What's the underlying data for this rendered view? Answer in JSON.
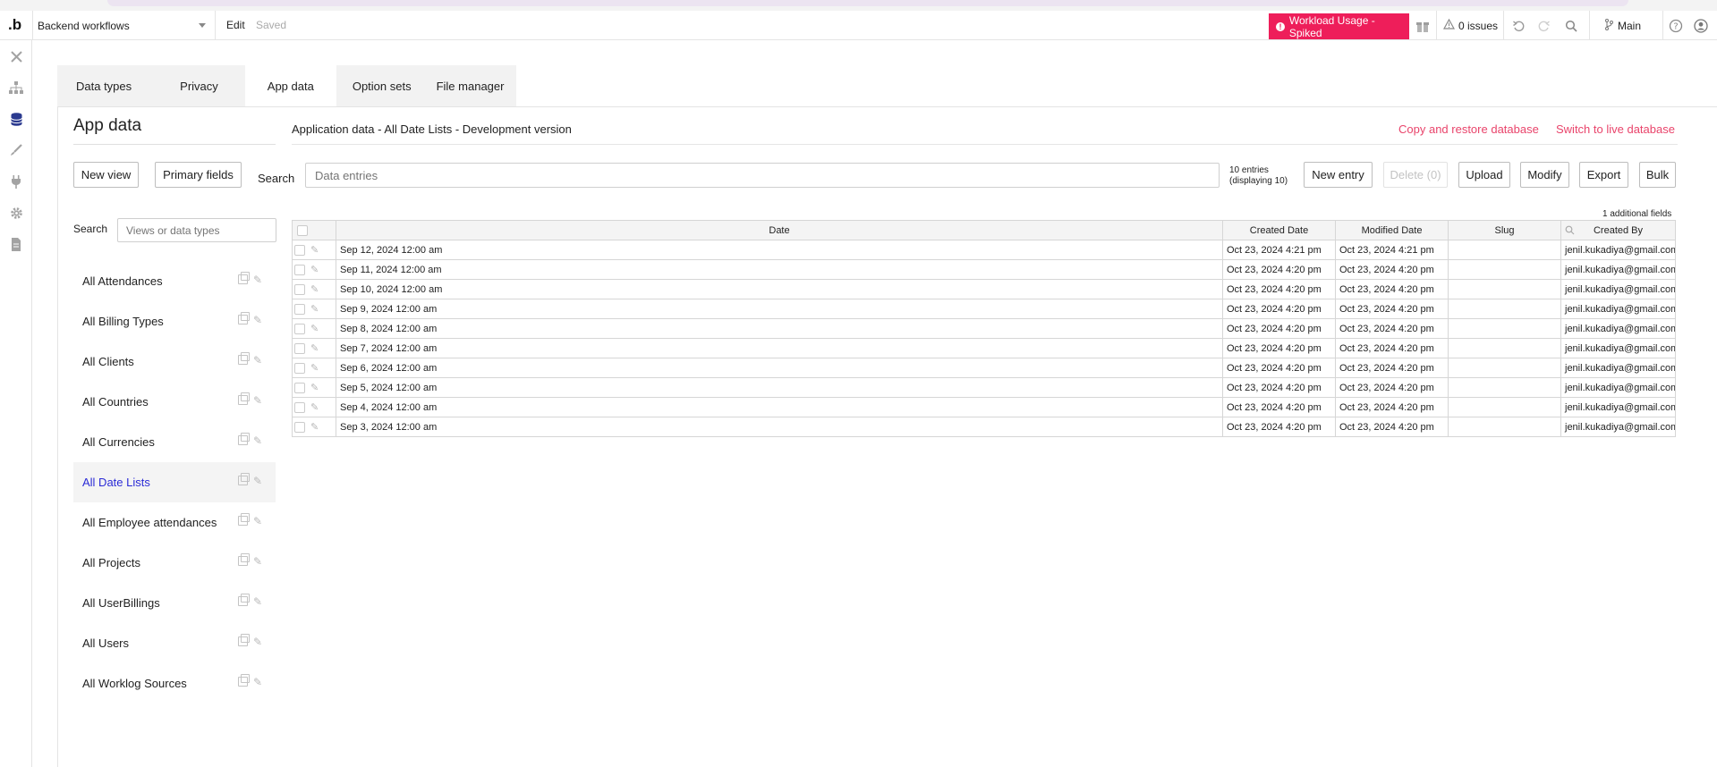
{
  "topbar": {
    "logo": ".b",
    "page_selector": "Backend workflows",
    "edit_label": "Edit",
    "saved_label": "Saved",
    "workload_label": "Workload Usage - Spiked",
    "issues_label": "0 issues",
    "branch_label": "Main",
    "colors": {
      "workload": "#ee1e5a",
      "link": "#e9446b",
      "active_nav": "#2b2bd6"
    }
  },
  "tabs": [
    {
      "label": "Data types"
    },
    {
      "label": "Privacy"
    },
    {
      "label": "App data"
    },
    {
      "label": "Option sets"
    },
    {
      "label": "File manager"
    }
  ],
  "left": {
    "title": "App data",
    "new_view": "New view",
    "primary_fields": "Primary fields",
    "search_label": "Search",
    "search_placeholder": "Views or data types",
    "types": [
      {
        "label": "All Attendances"
      },
      {
        "label": "All Billing Types"
      },
      {
        "label": "All Clients"
      },
      {
        "label": "All Countries"
      },
      {
        "label": "All Currencies"
      },
      {
        "label": "All Date Lists"
      },
      {
        "label": "All Employee attendances"
      },
      {
        "label": "All Projects"
      },
      {
        "label": "All UserBillings"
      },
      {
        "label": "All Users"
      },
      {
        "label": "All Worklog Sources"
      }
    ]
  },
  "main": {
    "headline": "Application data - All Date Lists - Development version",
    "copy_restore": "Copy and restore database",
    "switch_live": "Switch to live database",
    "search_label": "Search",
    "search_placeholder": "Data entries",
    "entries_line1": "10 entries",
    "entries_line2": "(displaying 10)",
    "buttons": {
      "new_entry": "New entry",
      "delete": "Delete (0)",
      "upload": "Upload",
      "modify": "Modify",
      "export": "Export",
      "bulk": "Bulk"
    },
    "additional_fields": "1 additional fields",
    "columns": [
      "Date",
      "Created Date",
      "Modified Date",
      "Slug",
      "Created By"
    ],
    "rows": [
      [
        "Sep 12, 2024 12:00 am",
        "Oct 23, 2024 4:21 pm",
        "Oct 23, 2024 4:21 pm",
        "",
        "jenil.kukadiya@gmail.com"
      ],
      [
        "Sep 11, 2024 12:00 am",
        "Oct 23, 2024 4:20 pm",
        "Oct 23, 2024 4:20 pm",
        "",
        "jenil.kukadiya@gmail.com"
      ],
      [
        "Sep 10, 2024 12:00 am",
        "Oct 23, 2024 4:20 pm",
        "Oct 23, 2024 4:20 pm",
        "",
        "jenil.kukadiya@gmail.com"
      ],
      [
        "Sep 9, 2024 12:00 am",
        "Oct 23, 2024 4:20 pm",
        "Oct 23, 2024 4:20 pm",
        "",
        "jenil.kukadiya@gmail.com"
      ],
      [
        "Sep 8, 2024 12:00 am",
        "Oct 23, 2024 4:20 pm",
        "Oct 23, 2024 4:20 pm",
        "",
        "jenil.kukadiya@gmail.com"
      ],
      [
        "Sep 7, 2024 12:00 am",
        "Oct 23, 2024 4:20 pm",
        "Oct 23, 2024 4:20 pm",
        "",
        "jenil.kukadiya@gmail.com"
      ],
      [
        "Sep 6, 2024 12:00 am",
        "Oct 23, 2024 4:20 pm",
        "Oct 23, 2024 4:20 pm",
        "",
        "jenil.kukadiya@gmail.com"
      ],
      [
        "Sep 5, 2024 12:00 am",
        "Oct 23, 2024 4:20 pm",
        "Oct 23, 2024 4:20 pm",
        "",
        "jenil.kukadiya@gmail.com"
      ],
      [
        "Sep 4, 2024 12:00 am",
        "Oct 23, 2024 4:20 pm",
        "Oct 23, 2024 4:20 pm",
        "",
        "jenil.kukadiya@gmail.com"
      ],
      [
        "Sep 3, 2024 12:00 am",
        "Oct 23, 2024 4:20 pm",
        "Oct 23, 2024 4:20 pm",
        "",
        "jenil.kukadiya@gmail.com"
      ]
    ]
  }
}
